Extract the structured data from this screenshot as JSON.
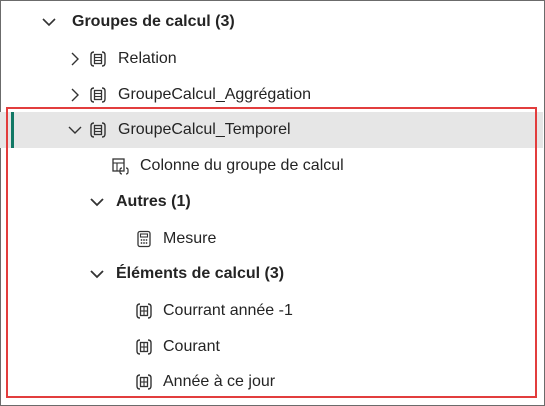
{
  "tree": {
    "root": {
      "label": "Groupes de calcul (3)",
      "expanded": true,
      "icon": "chevron-down-icon"
    },
    "items": [
      {
        "label": "Relation",
        "icon": "calc-group-icon",
        "expanded": false
      },
      {
        "label": "GroupeCalcul_Aggrégation",
        "icon": "calc-group-icon",
        "expanded": false
      },
      {
        "label": "GroupeCalcul_Temporel",
        "icon": "calc-group-icon",
        "expanded": true,
        "selected": true
      }
    ],
    "column": {
      "label": "Colonne du groupe de calcul",
      "icon": "calc-column-icon"
    },
    "others": {
      "label": "Autres (1)",
      "expanded": true,
      "children": [
        {
          "label": "Mesure",
          "icon": "calculator-icon"
        }
      ]
    },
    "calc_items": {
      "label": "Éléments de calcul (3)",
      "expanded": true,
      "children": [
        {
          "label": "Courrant année -1",
          "icon": "calc-item-icon"
        },
        {
          "label": "Courant",
          "icon": "calc-item-icon"
        },
        {
          "label": "Année à ce jour",
          "icon": "calc-item-icon"
        }
      ]
    }
  },
  "colors": {
    "selection_bar": "#117865",
    "highlight_border": "#e23d3d",
    "selected_bg": "#e6e6e6"
  }
}
